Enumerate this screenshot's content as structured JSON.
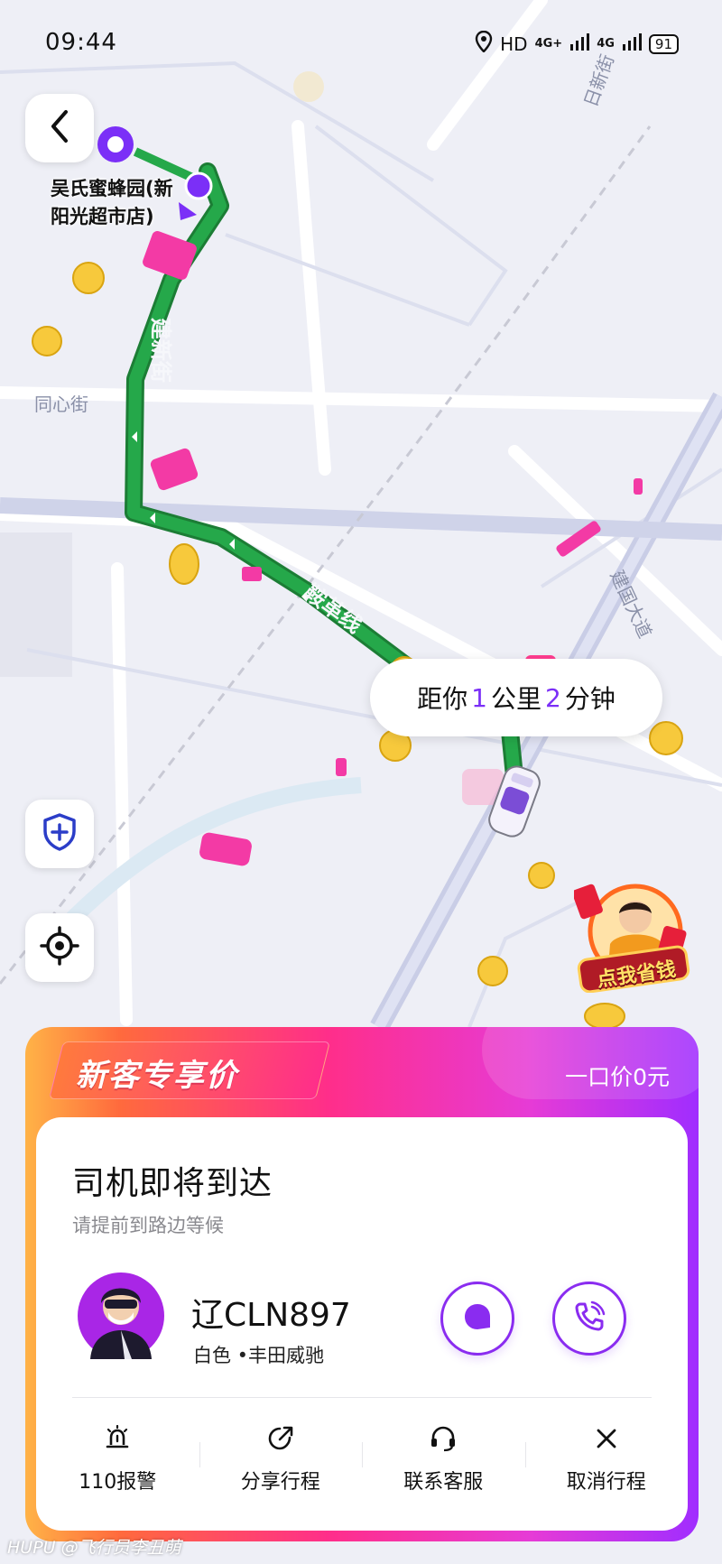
{
  "status_bar": {
    "time": "09:44",
    "network": "HD",
    "signal1": "4G+",
    "signal2": "4G",
    "battery": "91"
  },
  "map": {
    "destination_label_line1": "吴氏蜜蜂园(新",
    "destination_label_line2": "阳光超市店)",
    "streets": [
      "同心街",
      "同心街",
      "建新街",
      "鞍革线",
      "建国大道",
      "日新街"
    ],
    "eta": {
      "prefix": "距你",
      "distance": "1",
      "distance_unit": "公里",
      "minutes": "2",
      "minutes_unit": "分钟"
    },
    "promo_badge_text": "点我省钱"
  },
  "card": {
    "promo_tag": "新客专享价",
    "price_text": "一口价0元",
    "title": "司机即将到达",
    "subtitle": "请提前到路边等候",
    "driver": {
      "plate": "辽CLN897",
      "car_desc": "白色 •丰田威驰"
    },
    "actions": [
      {
        "label": "110报警",
        "icon": "alarm-icon"
      },
      {
        "label": "分享行程",
        "icon": "share-icon"
      },
      {
        "label": "联系客服",
        "icon": "headset-icon"
      },
      {
        "label": "取消行程",
        "icon": "close-icon"
      }
    ]
  },
  "watermark": "HUPU @飞行员李丑萌",
  "colors": {
    "route_green": "#1e9e44",
    "accent_purple": "#8a2cf0",
    "promo_pink": "#ff2e8a"
  }
}
